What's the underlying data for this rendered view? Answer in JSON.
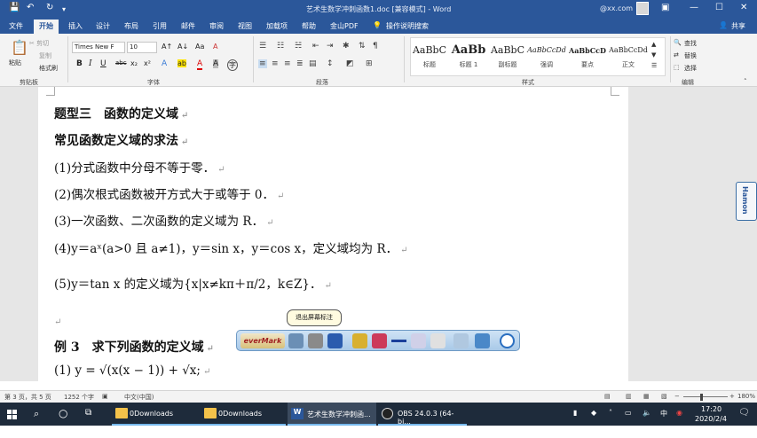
{
  "titlebar": {
    "title": "艺术生数学冲刺函数1.doc [兼容模式] - Word",
    "account": "@xx.com",
    "quick": {
      "save": "💾",
      "undo": "↶",
      "redo": "↻",
      "more": "▾"
    },
    "controls": {
      "ribbon_opts": "▣",
      "min": "—",
      "max": "☐",
      "close": "✕"
    }
  },
  "tabs": [
    "文件",
    "开始",
    "插入",
    "设计",
    "布局",
    "引用",
    "邮件",
    "审阅",
    "视图",
    "加载项",
    "帮助",
    "金山PDF",
    "操作说明搜索"
  ],
  "share": "共享",
  "ribbon": {
    "clipboard": {
      "paste": "粘贴",
      "cut": "✂ 剪切",
      "copy": "复制",
      "format_painter": "格式刷",
      "label": "剪贴板"
    },
    "font": {
      "name": "Times New F",
      "size": "10",
      "label": "字体",
      "grow": "A↑",
      "shrink": "A↓",
      "case": "Aa",
      "clear": "A",
      "bold": "B",
      "italic": "I",
      "underline": "U",
      "strike": "abc",
      "sub": "x₂",
      "sup": "x²",
      "effects": "A",
      "highlight": "ab",
      "color": "A",
      "charshade": "A",
      "enclose": "字"
    },
    "paragraph": {
      "label": "段落"
    },
    "styles": {
      "label": "样式",
      "items": [
        {
          "sample": "AaBbC",
          "name": "标题"
        },
        {
          "sample": "AaBb",
          "name": "标题 1"
        },
        {
          "sample": "AaBbC",
          "name": "副标题"
        },
        {
          "sample": "AaBbCcDd",
          "name": "强调"
        },
        {
          "sample": "AaBbCcD",
          "name": "要点"
        },
        {
          "sample": "AaBbCcDd",
          "name": "正文"
        }
      ]
    },
    "editing": {
      "find": "查找",
      "replace": "替换",
      "select": "选择",
      "label": "编辑"
    }
  },
  "document": {
    "lines": [
      "题型三　函数的定义域",
      "常见函数定义域的求法",
      "(1)分式函数中分母不等于零．",
      "(2)偶次根式函数被开方式大于或等于 0．",
      "(3)一次函数、二次函数的定义域为 R．",
      "(4)y＝aˣ(a>0 且 a≠1)，y＝sin x，y＝cos x，定义域均为 R．",
      "(5)y＝tan x 的定义域为{x|x≠kπ＋π/2，k∈Z}．",
      "",
      "例 3　求下列函数的定义域",
      "(1) y = √(x(x − 1)) + √x;"
    ],
    "para_mark": "↵"
  },
  "overlay": {
    "tooltip": "退出屏幕标注",
    "logo": "everMark"
  },
  "sidetab": "Hamon",
  "status": {
    "page": "第 3 页，共 5 页",
    "words": "1252 个字",
    "lang": "中文(中国)",
    "zoom": "180%",
    "minus": "−",
    "plus": "+"
  },
  "taskbar": {
    "items": [
      "0Downloads",
      "0Downloads",
      "艺术生数学冲刺函...",
      "OBS 24.0.3 (64-bi..."
    ],
    "time": "17:20",
    "date": "2020/2/4",
    "ime": "中"
  }
}
